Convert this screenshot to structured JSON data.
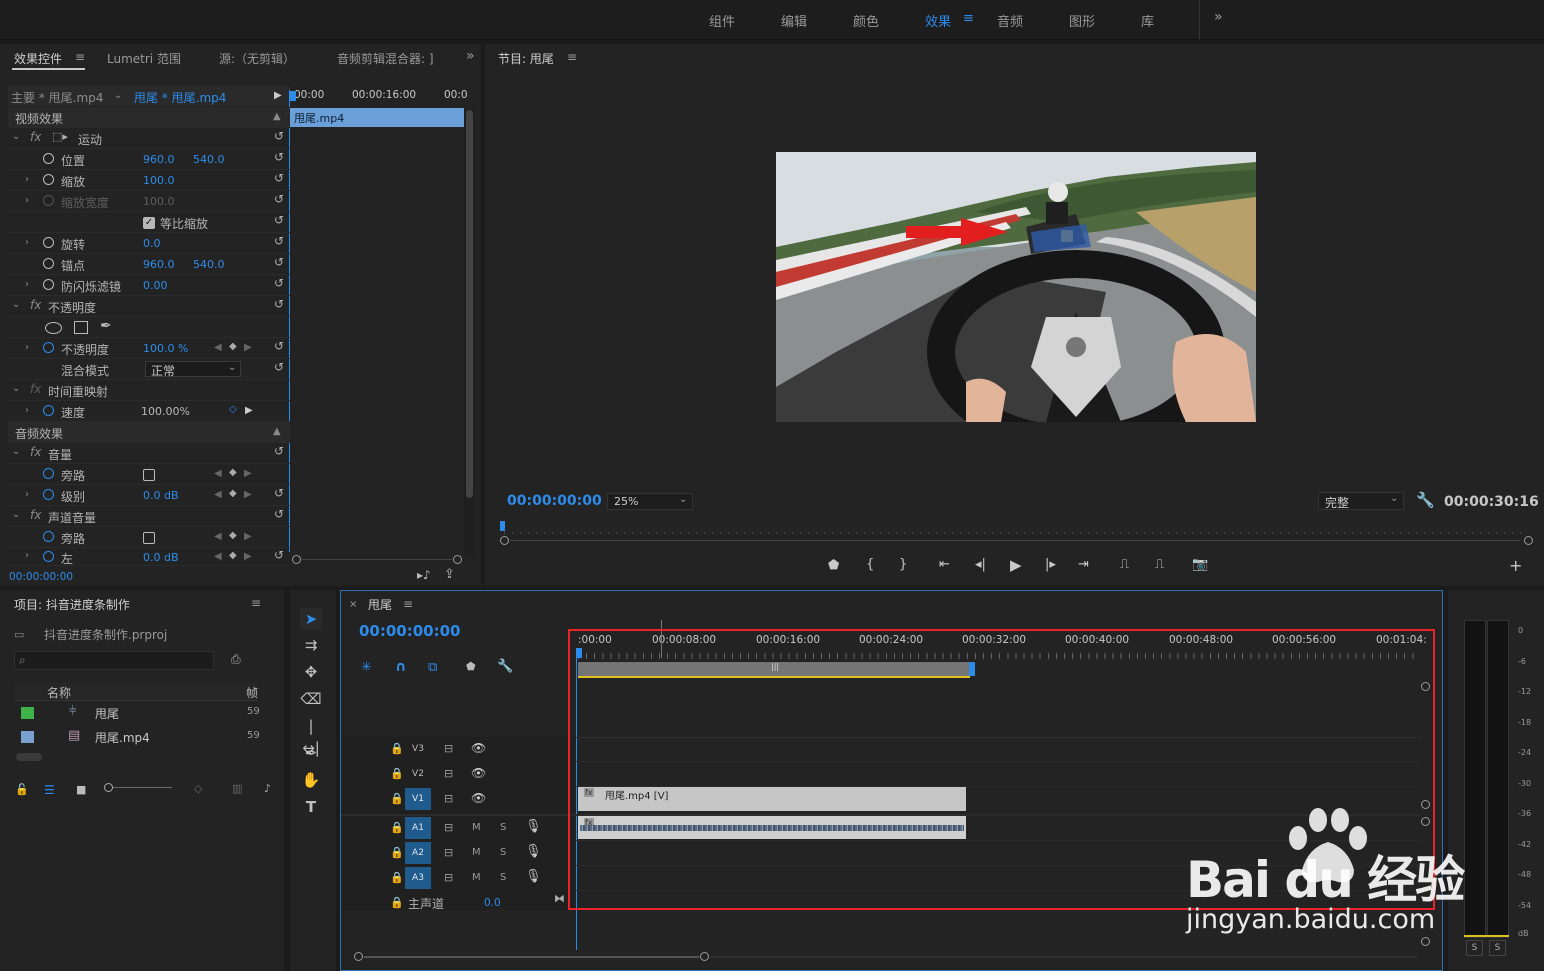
{
  "workspace_tabs": [
    "组件",
    "编辑",
    "颜色",
    "效果",
    "音频",
    "图形",
    "库"
  ],
  "workspace_active": "效果",
  "effect_controls": {
    "tabs": [
      "效果控件",
      "Lumetri 范围",
      "源:（无剪辑）",
      "音频剪辑混合器: ]"
    ],
    "master_clip": "主要 * 甩尾.mp4",
    "active_clip": "甩尾 * 甩尾.mp4",
    "ruler_times": [
      "00:00",
      "00:00:16:00",
      "00:0"
    ],
    "clip_name": "甩尾.mp4",
    "video_section": "视频效果",
    "motion": "运动",
    "position": {
      "label": "位置",
      "x": "960.0",
      "y": "540.0"
    },
    "scale": {
      "label": "缩放",
      "value": "100.0"
    },
    "scale_width": {
      "label": "缩放宽度",
      "value": "100.0"
    },
    "uniform_scale": "等比缩放",
    "rotation": {
      "label": "旋转",
      "value": "0.0"
    },
    "anchor": {
      "label": "锚点",
      "x": "960.0",
      "y": "540.0"
    },
    "antiflicker": {
      "label": "防闪烁滤镜",
      "value": "0.00"
    },
    "opacity_fx": "不透明度",
    "opacity": {
      "label": "不透明度",
      "value": "100.0 %"
    },
    "blend": {
      "label": "混合模式",
      "value": "正常"
    },
    "time_remap": "时间重映射",
    "speed": {
      "label": "速度",
      "value": "100.00%"
    },
    "audio_section": "音频效果",
    "volume_fx": "音量",
    "bypass": "旁路",
    "level": {
      "label": "级别",
      "value": "0.0 dB"
    },
    "channel_fx": "声道音量",
    "bypass2": "旁路",
    "left": {
      "label": "左",
      "value": "0.0 dB"
    },
    "timecode": "00:00:00:00"
  },
  "program": {
    "title": "节目: 甩尾",
    "timecode": "00:00:00:00",
    "zoom": "25%",
    "quality": "完整",
    "duration": "00:00:30:16"
  },
  "project": {
    "title": "项目: 抖音进度条制作",
    "file": "抖音进度条制作.prproj",
    "col_name": "名称",
    "col_frame": "帧",
    "items": [
      {
        "name": "甩尾",
        "frames": "59",
        "color": "#3db34a"
      },
      {
        "name": "甩尾.mp4",
        "frames": "59",
        "color": "#7aa0d0"
      }
    ]
  },
  "timeline": {
    "title": "甩尾",
    "timecode": "00:00:00:00",
    "ruler": [
      ":00:00",
      "00:00:08:00",
      "00:00:16:00",
      "00:00:24:00",
      "00:00:32:00",
      "00:00:40:00",
      "00:00:48:00",
      "00:00:56:00",
      "00:01:04:"
    ],
    "tracks": [
      "V3",
      "V2",
      "V1",
      "A1",
      "A2",
      "A3"
    ],
    "track_m": "M",
    "track_s": "S",
    "video_clip": "甩尾.mp4 [V]",
    "master": "主声道",
    "master_val": "0.0"
  },
  "meter": {
    "ticks": [
      "0",
      "-6",
      "-12",
      "-18",
      "-24",
      "-30",
      "-36",
      "-42",
      "-48",
      "-54",
      "dB"
    ],
    "solo": [
      "S",
      "S"
    ]
  },
  "watermark": {
    "brand": "Bai du 经验",
    "url": "jingyan.baidu.com"
  }
}
